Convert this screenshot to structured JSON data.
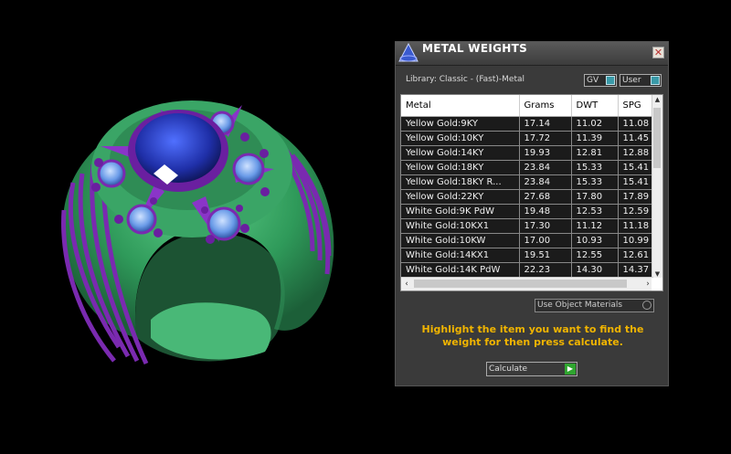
{
  "panel": {
    "title": "METAL WEIGHTS",
    "close_icon": "close-icon",
    "library_label": "Library: Classic - (Fast)-Metal",
    "toggles": [
      {
        "label": "GV"
      },
      {
        "label": "User"
      }
    ],
    "table": {
      "columns": [
        "Metal",
        "Grams",
        "DWT",
        "SPG"
      ],
      "rows": [
        [
          "Yellow Gold:9KY",
          "17.14",
          "11.02",
          "11.08"
        ],
        [
          "Yellow Gold:10KY",
          "17.72",
          "11.39",
          "11.45"
        ],
        [
          "Yellow Gold:14KY",
          "19.93",
          "12.81",
          "12.88"
        ],
        [
          "Yellow Gold:18KY",
          "23.84",
          "15.33",
          "15.41"
        ],
        [
          "Yellow Gold:18KY R...",
          "23.84",
          "15.33",
          "15.41"
        ],
        [
          "Yellow Gold:22KY",
          "27.68",
          "17.80",
          "17.89"
        ],
        [
          "White Gold:9K PdW",
          "19.48",
          "12.53",
          "12.59"
        ],
        [
          "White Gold:10KX1",
          "17.30",
          "11.12",
          "11.18"
        ],
        [
          "White Gold:10KW",
          "17.00",
          "10.93",
          "10.99"
        ],
        [
          "White Gold:14KX1",
          "19.51",
          "12.55",
          "12.61"
        ],
        [
          "White Gold:14K PdW",
          "22.23",
          "14.30",
          "14.37"
        ]
      ]
    },
    "use_object_materials": "Use Object Materials",
    "instructions": "Highlight the item you want to find the weight for then press calculate.",
    "calculate_label": "Calculate"
  },
  "colors": {
    "accent": "#f0b400",
    "ring_metal": "#7a2ab0",
    "ring_band": "#3fae6a",
    "gem": "#2a3fc0"
  }
}
